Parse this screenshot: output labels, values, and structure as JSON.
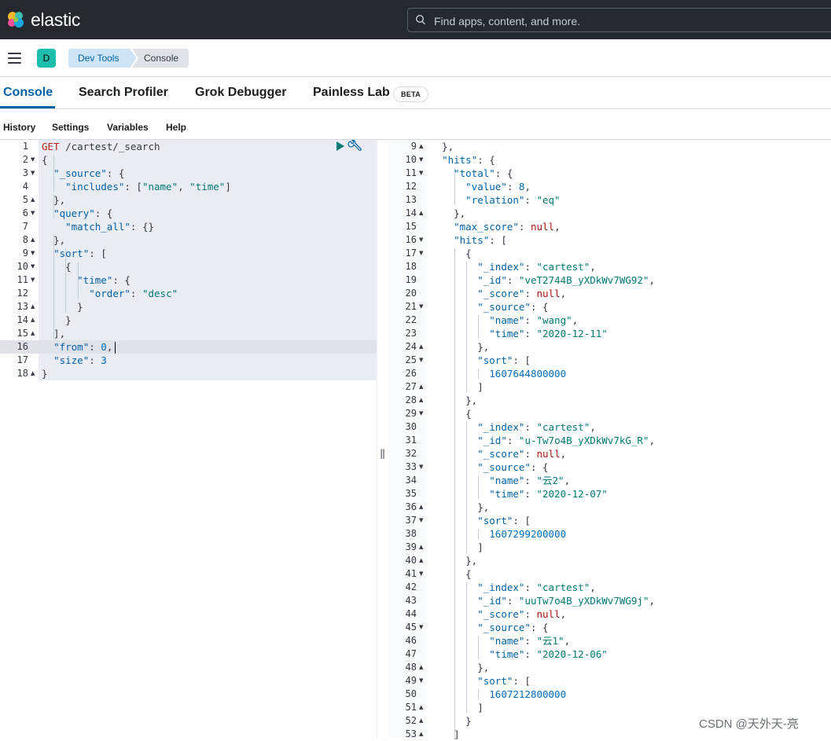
{
  "topbar": {
    "brand": "elastic",
    "search_placeholder": "Find apps, content, and more."
  },
  "subbar": {
    "avatar_letter": "D",
    "breadcrumbs": [
      "Dev Tools",
      "Console"
    ]
  },
  "tabs": {
    "console": "Console",
    "search_profiler": "Search Profiler",
    "grok_debugger": "Grok Debugger",
    "painless_lab": "Painless Lab",
    "beta": "BETA"
  },
  "menu": {
    "history": "History",
    "settings": "Settings",
    "variables": "Variables",
    "help": "Help"
  },
  "request": {
    "method": "GET",
    "path": " /cartest/_search",
    "lines": [
      [
        [
          "p",
          "{"
        ]
      ],
      [
        [
          "p",
          "  "
        ],
        [
          "k",
          "\"_source\""
        ],
        [
          "p",
          ": {"
        ]
      ],
      [
        [
          "p",
          "    "
        ],
        [
          "k",
          "\"includes\""
        ],
        [
          "p",
          ": ["
        ],
        [
          "s",
          "\"name\""
        ],
        [
          "p",
          ", "
        ],
        [
          "s",
          "\"time\""
        ],
        [
          "p",
          "]"
        ]
      ],
      [
        [
          "p",
          "  },"
        ]
      ],
      [
        [
          "p",
          "  "
        ],
        [
          "k",
          "\"query\""
        ],
        [
          "p",
          ": {"
        ]
      ],
      [
        [
          "p",
          "    "
        ],
        [
          "k",
          "\"match_all\""
        ],
        [
          "p",
          ": {}"
        ]
      ],
      [
        [
          "p",
          "  },"
        ]
      ],
      [
        [
          "p",
          "  "
        ],
        [
          "k",
          "\"sort\""
        ],
        [
          "p",
          ": ["
        ]
      ],
      [
        [
          "p",
          "    {"
        ]
      ],
      [
        [
          "p",
          "      "
        ],
        [
          "k",
          "\"time\""
        ],
        [
          "p",
          ": {"
        ]
      ],
      [
        [
          "p",
          "        "
        ],
        [
          "k",
          "\"order\""
        ],
        [
          "p",
          ": "
        ],
        [
          "s",
          "\"desc\""
        ]
      ],
      [
        [
          "p",
          "      }"
        ]
      ],
      [
        [
          "p",
          "    }"
        ]
      ],
      [
        [
          "p",
          "  ],"
        ]
      ],
      [
        [
          "p",
          "  "
        ],
        [
          "k",
          "\"from\""
        ],
        [
          "p",
          ": "
        ],
        [
          "n",
          "0"
        ],
        [
          "p",
          ","
        ]
      ],
      [
        [
          "p",
          "  "
        ],
        [
          "k",
          "\"size\""
        ],
        [
          "p",
          ": "
        ],
        [
          "n",
          "3"
        ]
      ],
      [
        [
          "p",
          "}"
        ]
      ]
    ],
    "line_numbers": [
      "1",
      "2",
      "3",
      "4",
      "5",
      "6",
      "7",
      "8",
      "9",
      "10",
      "11",
      "12",
      "13",
      "14",
      "15",
      "16",
      "17",
      "18"
    ],
    "folds": {
      "2": "down",
      "3": "down",
      "5": "up",
      "6": "down",
      "8": "up",
      "9": "down",
      "10": "down",
      "11": "down",
      "13": "up",
      "14": "up",
      "15": "up",
      "18": "up"
    }
  },
  "response": {
    "line_numbers": [
      "9",
      "10",
      "11",
      "12",
      "13",
      "14",
      "15",
      "16",
      "17",
      "18",
      "19",
      "20",
      "21",
      "22",
      "23",
      "24",
      "25",
      "26",
      "27",
      "28",
      "29",
      "30",
      "31",
      "32",
      "33",
      "34",
      "35",
      "36",
      "37",
      "38",
      "39",
      "40",
      "41",
      "42",
      "43",
      "44",
      "45",
      "46",
      "47",
      "48",
      "49",
      "50",
      "51",
      "52",
      "53"
    ],
    "folds": {
      "9": "up",
      "10": "down",
      "11": "down",
      "14": "up",
      "16": "down",
      "17": "down",
      "21": "down",
      "24": "up",
      "25": "down",
      "27": "up",
      "28": "up",
      "29": "down",
      "33": "down",
      "36": "up",
      "37": "down",
      "39": "up",
      "40": "up",
      "41": "down",
      "45": "down",
      "48": "up",
      "49": "down",
      "51": "up",
      "52": "up",
      "53": "up"
    },
    "lines": [
      [
        [
          "p",
          "  },"
        ]
      ],
      [
        [
          "p",
          "  "
        ],
        [
          "k",
          "\"hits\""
        ],
        [
          "p",
          ": {"
        ]
      ],
      [
        [
          "p",
          "    "
        ],
        [
          "k",
          "\"total\""
        ],
        [
          "p",
          ": {"
        ]
      ],
      [
        [
          "p",
          "      "
        ],
        [
          "k",
          "\"value\""
        ],
        [
          "p",
          ": "
        ],
        [
          "n",
          "8"
        ],
        [
          "p",
          ","
        ]
      ],
      [
        [
          "p",
          "      "
        ],
        [
          "k",
          "\"relation\""
        ],
        [
          "p",
          ": "
        ],
        [
          "s",
          "\"eq\""
        ]
      ],
      [
        [
          "p",
          "    },"
        ]
      ],
      [
        [
          "p",
          "    "
        ],
        [
          "k",
          "\"max_score\""
        ],
        [
          "p",
          ": "
        ],
        [
          "nl",
          "null"
        ],
        [
          "p",
          ","
        ]
      ],
      [
        [
          "p",
          "    "
        ],
        [
          "k",
          "\"hits\""
        ],
        [
          "p",
          ": ["
        ]
      ],
      [
        [
          "p",
          "      {"
        ]
      ],
      [
        [
          "p",
          "        "
        ],
        [
          "k",
          "\"_index\""
        ],
        [
          "p",
          ": "
        ],
        [
          "s",
          "\"cartest\""
        ],
        [
          "p",
          ","
        ]
      ],
      [
        [
          "p",
          "        "
        ],
        [
          "k",
          "\"_id\""
        ],
        [
          "p",
          ": "
        ],
        [
          "s",
          "\"veT2744B_yXDkWv7WG92\""
        ],
        [
          "p",
          ","
        ]
      ],
      [
        [
          "p",
          "        "
        ],
        [
          "k",
          "\"_score\""
        ],
        [
          "p",
          ": "
        ],
        [
          "nl",
          "null"
        ],
        [
          "p",
          ","
        ]
      ],
      [
        [
          "p",
          "        "
        ],
        [
          "k",
          "\"_source\""
        ],
        [
          "p",
          ": {"
        ]
      ],
      [
        [
          "p",
          "          "
        ],
        [
          "k",
          "\"name\""
        ],
        [
          "p",
          ": "
        ],
        [
          "s",
          "\"wang\""
        ],
        [
          "p",
          ","
        ]
      ],
      [
        [
          "p",
          "          "
        ],
        [
          "k",
          "\"time\""
        ],
        [
          "p",
          ": "
        ],
        [
          "s",
          "\"2020-12-11\""
        ]
      ],
      [
        [
          "p",
          "        },"
        ]
      ],
      [
        [
          "p",
          "        "
        ],
        [
          "k",
          "\"sort\""
        ],
        [
          "p",
          ": ["
        ]
      ],
      [
        [
          "p",
          "          "
        ],
        [
          "n",
          "1607644800000"
        ]
      ],
      [
        [
          "p",
          "        ]"
        ]
      ],
      [
        [
          "p",
          "      },"
        ]
      ],
      [
        [
          "p",
          "      {"
        ]
      ],
      [
        [
          "p",
          "        "
        ],
        [
          "k",
          "\"_index\""
        ],
        [
          "p",
          ": "
        ],
        [
          "s",
          "\"cartest\""
        ],
        [
          "p",
          ","
        ]
      ],
      [
        [
          "p",
          "        "
        ],
        [
          "k",
          "\"_id\""
        ],
        [
          "p",
          ": "
        ],
        [
          "s",
          "\"u-Tw7o4B_yXDkWv7kG_R\""
        ],
        [
          "p",
          ","
        ]
      ],
      [
        [
          "p",
          "        "
        ],
        [
          "k",
          "\"_score\""
        ],
        [
          "p",
          ": "
        ],
        [
          "nl",
          "null"
        ],
        [
          "p",
          ","
        ]
      ],
      [
        [
          "p",
          "        "
        ],
        [
          "k",
          "\"_source\""
        ],
        [
          "p",
          ": {"
        ]
      ],
      [
        [
          "p",
          "          "
        ],
        [
          "k",
          "\"name\""
        ],
        [
          "p",
          ": "
        ],
        [
          "s",
          "\"云2\""
        ],
        [
          "p",
          ","
        ]
      ],
      [
        [
          "p",
          "          "
        ],
        [
          "k",
          "\"time\""
        ],
        [
          "p",
          ": "
        ],
        [
          "s",
          "\"2020-12-07\""
        ]
      ],
      [
        [
          "p",
          "        },"
        ]
      ],
      [
        [
          "p",
          "        "
        ],
        [
          "k",
          "\"sort\""
        ],
        [
          "p",
          ": ["
        ]
      ],
      [
        [
          "p",
          "          "
        ],
        [
          "n",
          "1607299200000"
        ]
      ],
      [
        [
          "p",
          "        ]"
        ]
      ],
      [
        [
          "p",
          "      },"
        ]
      ],
      [
        [
          "p",
          "      {"
        ]
      ],
      [
        [
          "p",
          "        "
        ],
        [
          "k",
          "\"_index\""
        ],
        [
          "p",
          ": "
        ],
        [
          "s",
          "\"cartest\""
        ],
        [
          "p",
          ","
        ]
      ],
      [
        [
          "p",
          "        "
        ],
        [
          "k",
          "\"_id\""
        ],
        [
          "p",
          ": "
        ],
        [
          "s",
          "\"uuTw7o4B_yXDkWv7WG9j\""
        ],
        [
          "p",
          ","
        ]
      ],
      [
        [
          "p",
          "        "
        ],
        [
          "k",
          "\"_score\""
        ],
        [
          "p",
          ": "
        ],
        [
          "nl",
          "null"
        ],
        [
          "p",
          ","
        ]
      ],
      [
        [
          "p",
          "        "
        ],
        [
          "k",
          "\"_source\""
        ],
        [
          "p",
          ": {"
        ]
      ],
      [
        [
          "p",
          "          "
        ],
        [
          "k",
          "\"name\""
        ],
        [
          "p",
          ": "
        ],
        [
          "s",
          "\"云1\""
        ],
        [
          "p",
          ","
        ]
      ],
      [
        [
          "p",
          "          "
        ],
        [
          "k",
          "\"time\""
        ],
        [
          "p",
          ": "
        ],
        [
          "s",
          "\"2020-12-06\""
        ]
      ],
      [
        [
          "p",
          "        },"
        ]
      ],
      [
        [
          "p",
          "        "
        ],
        [
          "k",
          "\"sort\""
        ],
        [
          "p",
          ": ["
        ]
      ],
      [
        [
          "p",
          "          "
        ],
        [
          "n",
          "1607212800000"
        ]
      ],
      [
        [
          "p",
          "        ]"
        ]
      ],
      [
        [
          "p",
          "      }"
        ]
      ],
      [
        [
          "p",
          "    ]"
        ]
      ]
    ]
  },
  "watermark": "CSDN @天外天-亮",
  "colors": {
    "topbar": "#25282f",
    "accent": "#0061a6",
    "avatar": "#1dbfac",
    "editor_bg": "#e9ecf3"
  },
  "icons": [
    "elastic-logo",
    "search-icon",
    "menu-icon",
    "play-icon",
    "wrench-icon"
  ]
}
